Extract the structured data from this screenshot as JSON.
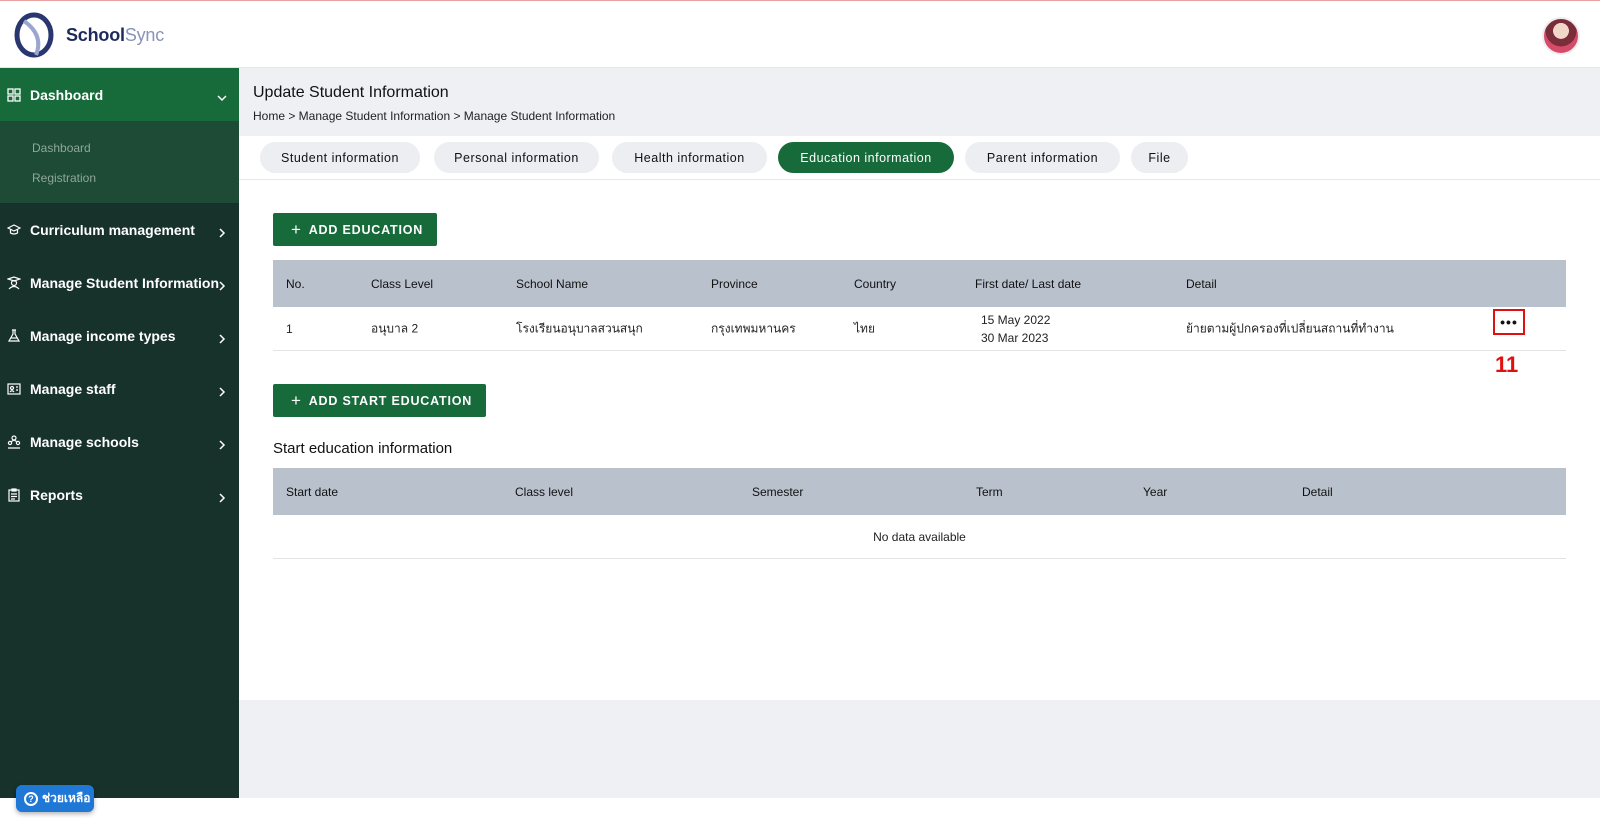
{
  "app": {
    "name_bold": "School",
    "name_light": "Sync"
  },
  "sidebar": {
    "items": [
      {
        "label": "Dashboard",
        "icon": "grid-icon"
      },
      {
        "label": "Curriculum management",
        "icon": "graduation-cap-icon"
      },
      {
        "label": "Manage Student Information",
        "icon": "student-icon"
      },
      {
        "label": "Manage income types",
        "icon": "flask-icon"
      },
      {
        "label": "Manage staff",
        "icon": "id-card-icon"
      },
      {
        "label": "Manage schools",
        "icon": "people-icon"
      },
      {
        "label": "Reports",
        "icon": "clipboard-icon"
      }
    ],
    "submenu": [
      "Dashboard",
      "Registration"
    ]
  },
  "page": {
    "title": "Update Student Information",
    "breadcrumb": "Home > Manage Student Information > Manage Student Information"
  },
  "tabs": [
    "Student information",
    "Personal information",
    "Health information",
    "Education information",
    "Parent information",
    "File"
  ],
  "active_tab": "Education information",
  "education": {
    "add_label": "ADD EDUCATION",
    "columns": [
      "No.",
      "Class Level",
      "School Name",
      "Province",
      "Country",
      "First date/ Last date",
      "Detail"
    ],
    "rows": [
      {
        "no": "1",
        "class_level": "อนุบาล 2",
        "school_name": "โรงเรียนอนุบาลสวนสนุก",
        "province": "กรุงเทพมหานคร",
        "country": "ไทย",
        "first_date": "15 May 2022",
        "last_date": "30 Mar 2023",
        "detail": "ย้ายตามผู้ปกครองที่เปลี่ยนสถานที่ทำงาน",
        "action": "•••"
      }
    ],
    "step_marker": "11"
  },
  "start_education": {
    "add_label": "ADD START EDUCATION",
    "title": "Start education information",
    "columns": [
      "Start date",
      "Class level",
      "Semester",
      "Term",
      "Year",
      "Detail"
    ],
    "empty_text": "No data available"
  },
  "help": {
    "label": "ช่วยเหลือ"
  },
  "colors": {
    "primary_green": "#176a3a",
    "sidebar_bg": "#17312b",
    "highlight_red": "#e01010",
    "help_blue": "#1f77d6"
  }
}
